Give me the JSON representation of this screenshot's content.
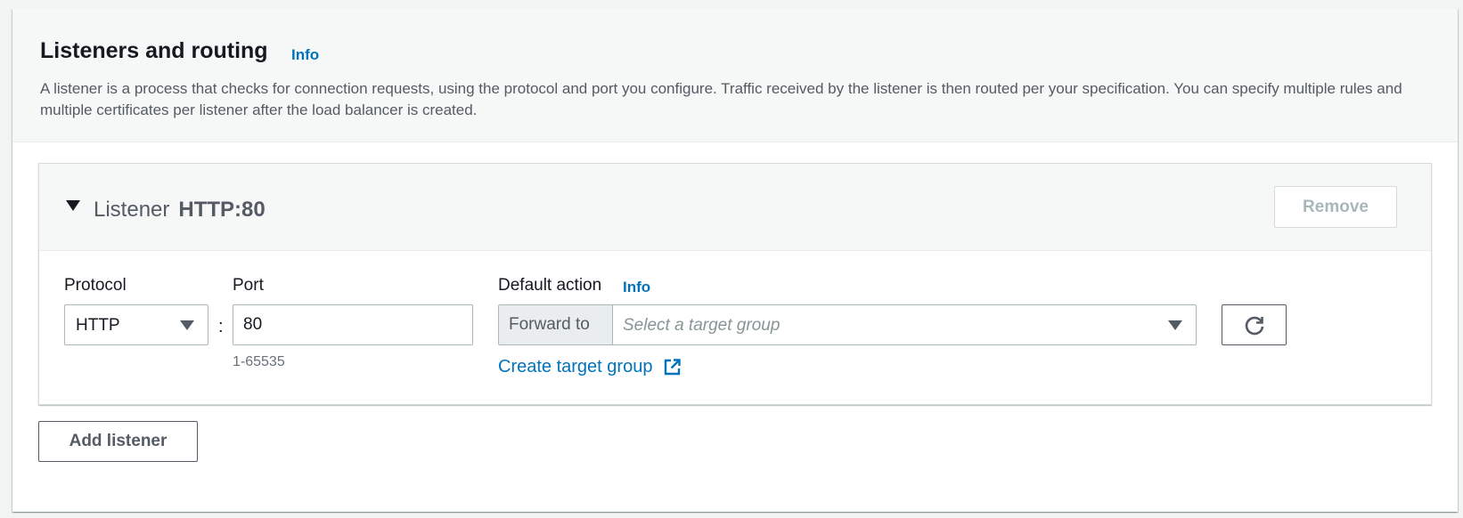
{
  "section": {
    "title": "Listeners and routing",
    "info_label": "Info",
    "description": "A listener is a process that checks for connection requests, using the protocol and port you configure. Traffic received by the listener is then routed per your specification. You can specify multiple rules and multiple certificates per listener after the load balancer is created."
  },
  "listener": {
    "heading_label": "Listener",
    "heading_value": "HTTP:80",
    "remove_label": "Remove",
    "protocol": {
      "label": "Protocol",
      "selected": "HTTP"
    },
    "separator": ":",
    "port": {
      "label": "Port",
      "value": "80",
      "hint": "1-65535"
    },
    "default_action": {
      "label": "Default action",
      "info_label": "Info",
      "addon_label": "Forward to",
      "placeholder": "Select a target group",
      "create_link": "Create target group"
    }
  },
  "add_listener_label": "Add listener",
  "colors": {
    "link": "#0073bb",
    "header_bg": "#f6f7f7",
    "border": "#aab7b8",
    "text": "#16191f",
    "muted": "#545b64"
  },
  "icons": [
    "caret-down-icon",
    "dropdown-arrow-icon",
    "external-link-icon",
    "refresh-icon"
  ]
}
